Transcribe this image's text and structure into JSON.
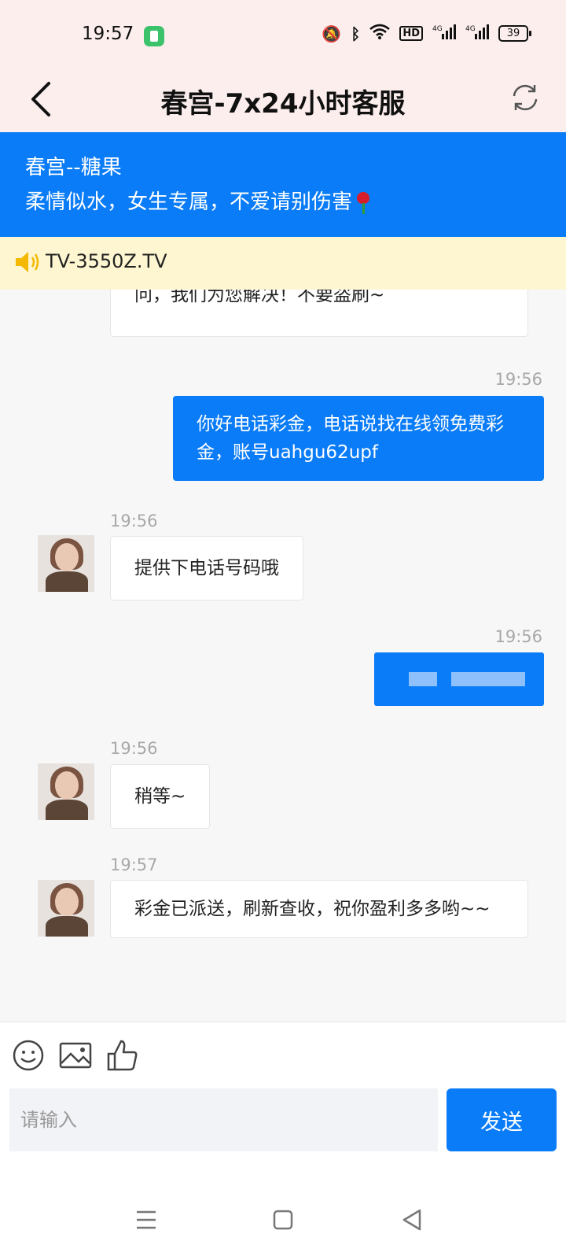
{
  "status_bar": {
    "time": "19:57",
    "battery": "39",
    "network": "4G"
  },
  "header": {
    "title": "春宫-7x24小时客服"
  },
  "agent_banner": {
    "name": "春宫--糖果",
    "description": "柔情似水，女生专属，不爱请别伤害"
  },
  "notice": {
    "text": "TV-3550Z.TV"
  },
  "messages": [
    {
      "side": "left",
      "partial_text": "问，我们为您解决！不要盗刷~"
    },
    {
      "side": "right",
      "time": "19:56",
      "text": "你好电话彩金，电话说找在线领免费彩金，账号uahgu62upf"
    },
    {
      "side": "left",
      "time": "19:56",
      "text": "提供下电话号码哦"
    },
    {
      "side": "right",
      "time": "19:56",
      "text": ""
    },
    {
      "side": "left",
      "time": "19:56",
      "text": "稍等~"
    },
    {
      "side": "left",
      "time": "19:57",
      "text": "彩金已派送，刷新查收，祝你盈利多多哟~~"
    }
  ],
  "composer": {
    "placeholder": "请输入",
    "send_label": "发送"
  },
  "colors": {
    "accent": "#0a7cf7",
    "header_bg": "#fdeeee",
    "notice_bg": "#fdf6d0"
  }
}
